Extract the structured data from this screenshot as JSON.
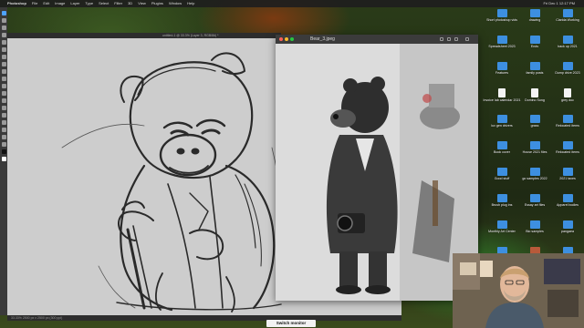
{
  "menubar": {
    "items": [
      "Photoshop",
      "File",
      "Edit",
      "Image",
      "Layer",
      "Type",
      "Select",
      "Filter",
      "3D",
      "View",
      "Plugins",
      "Window",
      "Help"
    ],
    "clock": "Fri Dec 1  12:17 PM"
  },
  "canvas": {
    "tab_title": "untitled-1 @ 33.3% (Layer 3, RGB/8#) *",
    "status": "33.33%   2500 px x 2500 px (300 ppi)"
  },
  "reference": {
    "title": "Bear_3.jpeg"
  },
  "desktop_icons": [
    {
      "label": "Short photoshop vids",
      "kind": "folder"
    },
    {
      "label": "drawing",
      "kind": "folder"
    },
    {
      "label": "Clarida Working",
      "kind": "folder"
    },
    {
      "label": "Spreadsheet 2023",
      "kind": "folder"
    },
    {
      "label": "Ends",
      "kind": "folder"
    },
    {
      "label": "back up 2021",
      "kind": "folder"
    },
    {
      "label": "Features",
      "kind": "folder"
    },
    {
      "label": "family posts",
      "kind": "folder"
    },
    {
      "label": "Dump drive 2023",
      "kind": "folder"
    },
    {
      "label": "Invoice lab calendar 2021",
      "kind": "doc"
    },
    {
      "label": "Domino Song",
      "kind": "doc"
    },
    {
      "label": "grey doc",
      "kind": "doc"
    },
    {
      "label": "lux gen drivers",
      "kind": "folder"
    },
    {
      "label": "grass",
      "kind": "folder"
    },
    {
      "label": "Relocated items",
      "kind": "folder"
    },
    {
      "label": "Book cover",
      "kind": "folder"
    },
    {
      "label": "House 2021 files",
      "kind": "folder"
    },
    {
      "label": "Relocated items",
      "kind": "folder"
    },
    {
      "label": "Good stuff",
      "kind": "folder"
    },
    {
      "label": "go samples 2022",
      "kind": "folder"
    },
    {
      "label": "2021 taxes",
      "kind": "folder"
    },
    {
      "label": "Brush plug ins",
      "kind": "folder"
    },
    {
      "label": "Essay art files",
      "kind": "folder"
    },
    {
      "label": "Apparel bodies",
      "kind": "folder"
    },
    {
      "label": "Monthly Art Center",
      "kind": "folder"
    },
    {
      "label": "Bio samples",
      "kind": "folder"
    },
    {
      "label": "pangaea",
      "kind": "folder"
    },
    {
      "label": "Coloring books",
      "kind": "folder"
    },
    {
      "label": "Pinterest art",
      "kind": "pic"
    },
    {
      "label": "Carnival Baseball_samples",
      "kind": "folder"
    }
  ],
  "switch_button": "Switch monitor",
  "colors": {
    "accent": "#4ea3ff",
    "folder": "#3d8fe0"
  }
}
